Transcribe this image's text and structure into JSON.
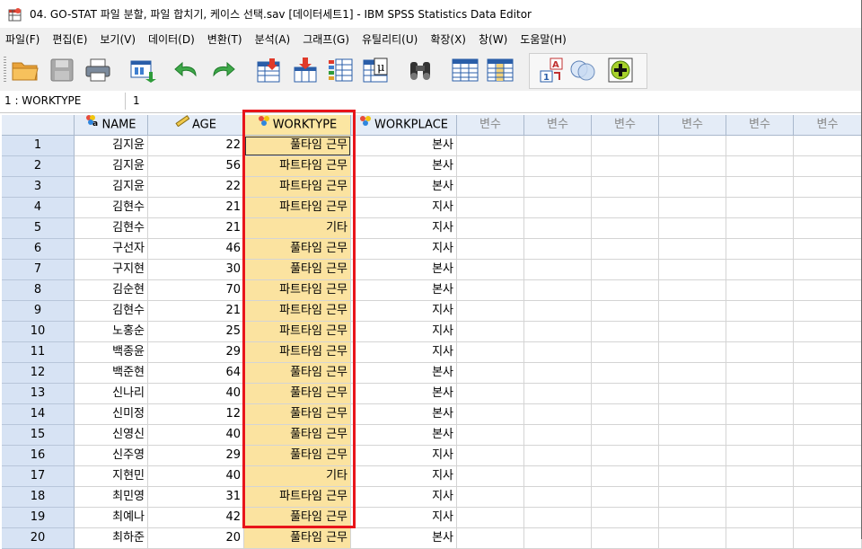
{
  "window": {
    "title": "04. GO-STAT 파일 분할, 파일 합치기, 케이스 선택.sav [데이터세트1] - IBM SPSS Statistics Data Editor"
  },
  "menu": [
    "파일(F)",
    "편집(E)",
    "보기(V)",
    "데이터(D)",
    "변환(T)",
    "분석(A)",
    "그래프(G)",
    "유틸리티(U)",
    "확장(X)",
    "창(W)",
    "도움말(H)"
  ],
  "toolbar_icons": [
    "open-folder-icon",
    "save-icon",
    "print-icon",
    "recall-dialog-icon",
    "undo-icon",
    "redo-icon",
    "go-to-case-icon",
    "go-to-variable-icon",
    "variables-icon",
    "run-descriptives-icon",
    "find-icon",
    "insert-cases-icon",
    "insert-variable-icon",
    "split-file-icon",
    "weight-cases-icon",
    "select-cases-icon",
    "value-labels-icon",
    "use-variable-sets-icon",
    "show-all-variables-icon"
  ],
  "cell_editor": {
    "ref": "1 : WORKTYPE",
    "value": "1"
  },
  "columns": [
    {
      "name": "NAME",
      "type": "nominal"
    },
    {
      "name": "AGE",
      "type": "scale"
    },
    {
      "name": "WORKTYPE",
      "type": "nominal"
    },
    {
      "name": "WORKPLACE",
      "type": "nominal"
    },
    {
      "name": "변수",
      "type": "empty"
    },
    {
      "name": "변수",
      "type": "empty"
    },
    {
      "name": "변수",
      "type": "empty"
    },
    {
      "name": "변수",
      "type": "empty"
    },
    {
      "name": "변수",
      "type": "empty"
    },
    {
      "name": "변수",
      "type": "empty"
    }
  ],
  "rows": [
    {
      "n": "1",
      "name": "김지윤",
      "age": "22",
      "worktype": "풀타임 근무",
      "workplace": "본사"
    },
    {
      "n": "2",
      "name": "김지윤",
      "age": "56",
      "worktype": "파트타임 근무",
      "workplace": "본사"
    },
    {
      "n": "3",
      "name": "김지윤",
      "age": "22",
      "worktype": "파트타임 근무",
      "workplace": "본사"
    },
    {
      "n": "4",
      "name": "김현수",
      "age": "21",
      "worktype": "파트타임 근무",
      "workplace": "지사"
    },
    {
      "n": "5",
      "name": "김현수",
      "age": "21",
      "worktype": "기타",
      "workplace": "지사"
    },
    {
      "n": "6",
      "name": "구선자",
      "age": "46",
      "worktype": "풀타임 근무",
      "workplace": "지사"
    },
    {
      "n": "7",
      "name": "구지현",
      "age": "30",
      "worktype": "풀타임 근무",
      "workplace": "본사"
    },
    {
      "n": "8",
      "name": "김순현",
      "age": "70",
      "worktype": "파트타임 근무",
      "workplace": "본사"
    },
    {
      "n": "9",
      "name": "김현수",
      "age": "21",
      "worktype": "파트타임 근무",
      "workplace": "지사"
    },
    {
      "n": "10",
      "name": "노홍순",
      "age": "25",
      "worktype": "파트타임 근무",
      "workplace": "지사"
    },
    {
      "n": "11",
      "name": "백종윤",
      "age": "29",
      "worktype": "파트타임 근무",
      "workplace": "지사"
    },
    {
      "n": "12",
      "name": "백준현",
      "age": "64",
      "worktype": "풀타임 근무",
      "workplace": "본사"
    },
    {
      "n": "13",
      "name": "신나리",
      "age": "40",
      "worktype": "풀타임 근무",
      "workplace": "본사"
    },
    {
      "n": "14",
      "name": "신미정",
      "age": "12",
      "worktype": "풀타임 근무",
      "workplace": "본사"
    },
    {
      "n": "15",
      "name": "신영신",
      "age": "40",
      "worktype": "풀타임 근무",
      "workplace": "본사"
    },
    {
      "n": "16",
      "name": "신주영",
      "age": "29",
      "worktype": "풀타임 근무",
      "workplace": "지사"
    },
    {
      "n": "17",
      "name": "지현민",
      "age": "40",
      "worktype": "기타",
      "workplace": "지사"
    },
    {
      "n": "18",
      "name": "최민영",
      "age": "31",
      "worktype": "파트타임 근무",
      "workplace": "지사"
    },
    {
      "n": "19",
      "name": "최예나",
      "age": "42",
      "worktype": "풀타임 근무",
      "workplace": "지사"
    },
    {
      "n": "20",
      "name": "최하준",
      "age": "20",
      "worktype": "풀타임 근무",
      "workplace": "본사"
    }
  ],
  "colors": {
    "highlight_column": "#fbe3a0",
    "annotation_box": "#e8151b",
    "header_bg": "#e4ecf7",
    "row_number_bg": "#d7e3f4"
  }
}
